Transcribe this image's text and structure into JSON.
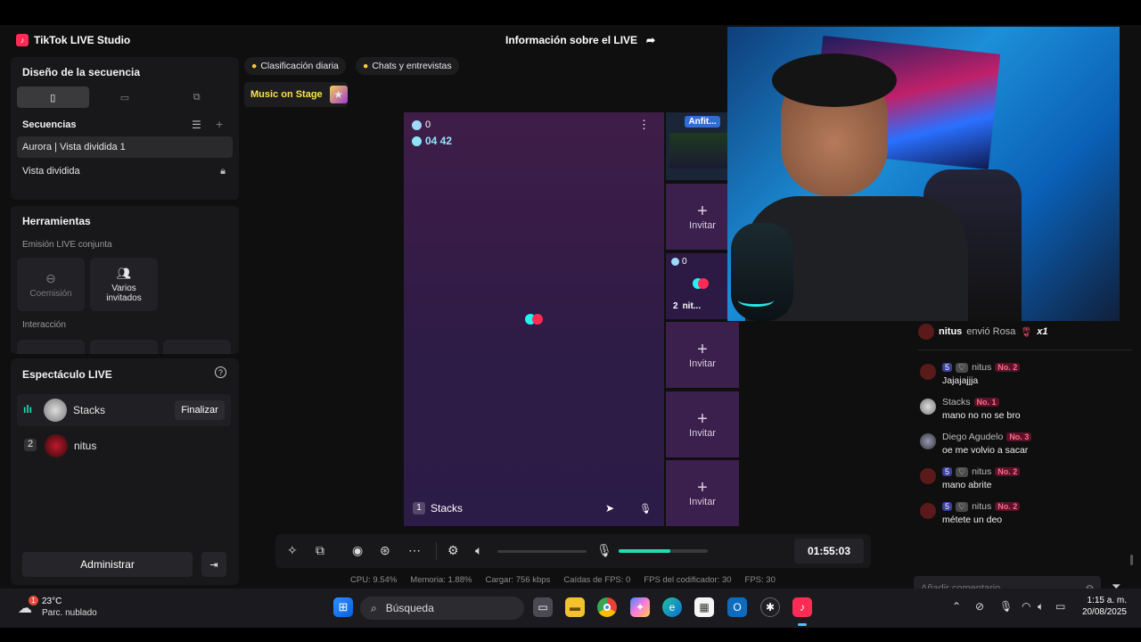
{
  "app": {
    "title": "TikTok LIVE Studio",
    "live_info": "Información sobre el LIVE"
  },
  "sequence_design": {
    "title": "Diseño de la secuencia",
    "sequences_label": "Secuencias",
    "items": [
      {
        "label": "Aurora | Vista dividida 1"
      },
      {
        "label": "Vista dividida"
      }
    ]
  },
  "tools": {
    "title": "Herramientas",
    "joint_live_label": "Emisión LIVE conjunta",
    "cohost_label": "Coemisión",
    "multi_guest_label": "Varios invitados",
    "interaction_label": "Interacción"
  },
  "live_show": {
    "title": "Espectáculo LIVE",
    "performers": [
      {
        "rank": "",
        "name": "Stacks",
        "action": "Finalizar"
      },
      {
        "rank": "2",
        "name": "nitus"
      }
    ],
    "manage_label": "Administrar"
  },
  "top_chips": {
    "daily_ranking": "Clasificación diaria",
    "chats": "Chats y entrevistas",
    "music_on_stage": "Music on Stage"
  },
  "stage": {
    "coins": "0",
    "timer": "04 42",
    "host_rank": "1",
    "host_name": "Stacks"
  },
  "guest_slots": {
    "top_label": "Anfit...",
    "guest": {
      "coins": "0",
      "rank": "2",
      "name": "nit..."
    },
    "invite_label": "Invitar"
  },
  "controls": {
    "duration": "01:55:03",
    "volume_level": 0,
    "mic_level": 0.58
  },
  "stats": {
    "cpu": "CPU: 9.54%",
    "memory": "Memoria: 1.88%",
    "load": "Cargar: 756 kbps",
    "fps_drops": "Caídas de FPS: 0",
    "encoder_fps": "FPS del codificador: 30",
    "fps": "FPS: 30"
  },
  "chat": {
    "gift": {
      "user": "nitus",
      "text": "envió Rosa",
      "count": "x1"
    },
    "messages": [
      {
        "level": "5",
        "name": "nitus",
        "rank": "No. 2",
        "text": "Jajajajjja"
      },
      {
        "level": "",
        "name": "Stacks",
        "rank": "No. 1",
        "text": "mano no no se bro"
      },
      {
        "level": "",
        "name": "Diego Agudelo",
        "rank": "No. 3",
        "text": "oe me volvio a sacar"
      },
      {
        "level": "5",
        "name": "nitus",
        "rank": "No. 2",
        "text": "mano abrite"
      },
      {
        "level": "5",
        "name": "nitus",
        "rank": "No. 2",
        "text": "métete un deo"
      }
    ],
    "comment_placeholder": "Añadir comentario"
  },
  "taskbar": {
    "weather_temp": "23°C",
    "weather_desc": "Parc. nublado",
    "weather_badge": "1",
    "search_label": "Búsqueda",
    "time": "1:15 a. m.",
    "date": "20/08/2025"
  },
  "colors": {
    "accent": "#fe2c55",
    "stage_bg": "#3f1d48",
    "mic_bar": "#25d9b0"
  }
}
